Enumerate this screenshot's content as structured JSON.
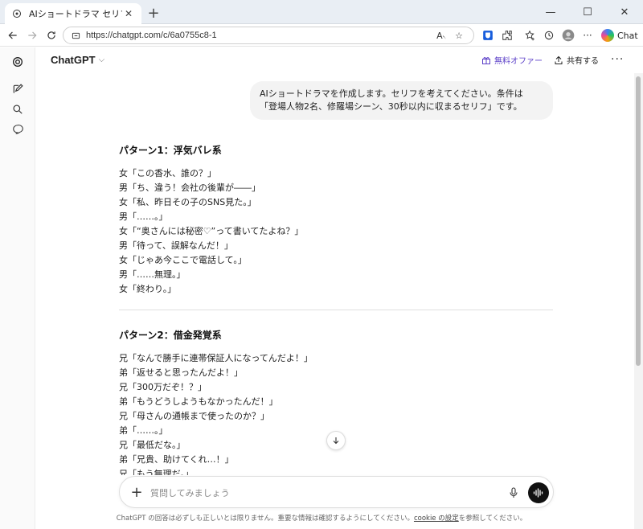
{
  "browser": {
    "tab_title": "AIショートドラマ セリフ",
    "url": "https://chatgpt.com/c/6a0755c8-1",
    "copilot_label": "Chat"
  },
  "header": {
    "model": "ChatGPT",
    "offer": "無料オファー",
    "share": "共有する"
  },
  "user_message": {
    "line1": "AIショートドラマを作成します。セリフを考えてください。条件は",
    "line2": "「登場人物2名、修羅場シーン、30秒以内に収まるセリフ」です。"
  },
  "patterns": [
    {
      "title": "パターン1：浮気バレ系",
      "lines": [
        "女「この香水、誰の？」",
        "男「ち、違う！会社の後輩が――」",
        "女「私、昨日その子のSNS見た。」",
        "男「……。」",
        "女「“奥さんには秘密♡”って書いてたよね？」",
        "男「待って、誤解なんだ！」",
        "女「じゃあ今ここで電話して。」",
        "男「……無理。」",
        "女「終わり。」"
      ]
    },
    {
      "title": "パターン2：借金発覚系",
      "lines": [
        "兄「なんで勝手に連帯保証人になってんだよ！」",
        "弟「返せると思ったんだよ！」",
        "兄「300万だぞ！？」",
        "弟「もうどうしようもなかったんだ！」",
        "兄「母さんの通帳まで使ったのか？」",
        "弟「……。」",
        "兄「最低だな。」",
        "弟「兄貴、助けてくれ…！」",
        "兄「もう無理だ。」"
      ]
    }
  ],
  "composer": {
    "placeholder": "質問してみましょう"
  },
  "disclaimer": {
    "before": "ChatGPT の回答は必ずしも正しいとは限りません。重要な情報は確認するようにしてください。",
    "link": "cookie の設定",
    "after": "を参照してください。"
  },
  "colors": {
    "offer": "#5b3fc8",
    "voice_button": "#111111",
    "bubble": "#f3f3f3"
  }
}
